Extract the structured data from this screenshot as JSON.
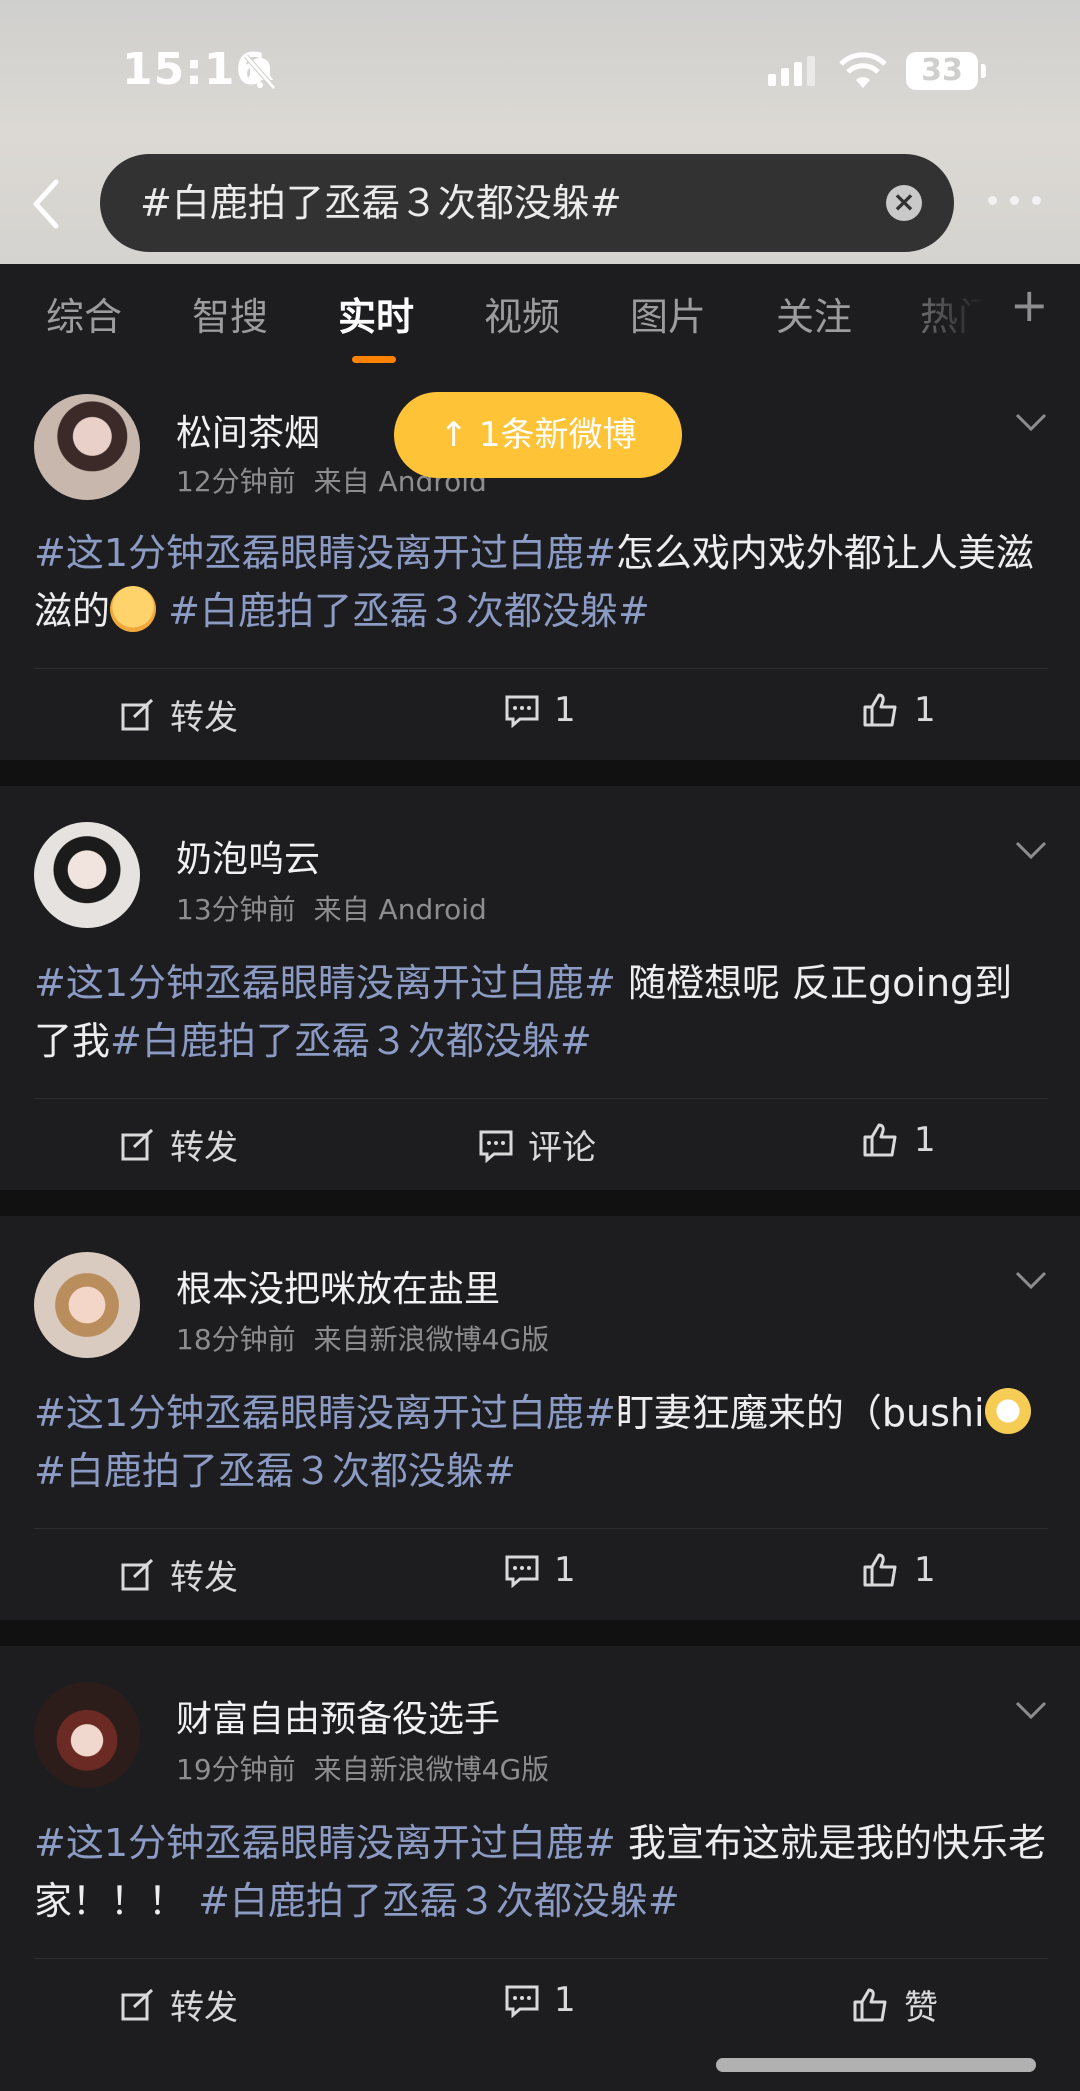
{
  "status_bar": {
    "time": "15:16",
    "battery": "33"
  },
  "search": {
    "query": "#白鹿拍了丞磊３次都没躲#",
    "clear": "×"
  },
  "tabs": [
    "综合",
    "智搜",
    "实时",
    "视频",
    "图片",
    "关注",
    "热门"
  ],
  "active_tab": "实时",
  "tab_plus": "+",
  "new_posts_banner": "↑ 1条新微博",
  "posts": [
    {
      "user": "松间茶烟",
      "time": "12分钟前",
      "source": "来自 Android",
      "content_parts": [
        "#这1分钟丞磊眼睛没离开过白鹿#",
        "怎么戏内戏外都让人美滋滋的",
        "#白鹿拍了丞磊３次都没躲#"
      ],
      "repost": "转发",
      "comment": "1",
      "like": "1"
    },
    {
      "user": "奶泡呜云",
      "time": "13分钟前",
      "source": "来自 Android",
      "content_parts": [
        "#这1分钟丞磊眼睛没离开过白鹿#",
        " 随橙想呢 反正going到了我",
        "#白鹿拍了丞磊３次都没躲#"
      ],
      "repost": "转发",
      "comment": "评论",
      "like": "1"
    },
    {
      "user": "根本没把咪放在盐里",
      "time": "18分钟前",
      "source": "来自新浪微博4G版",
      "content_parts": [
        "#这1分钟丞磊眼睛没离开过白鹿#",
        "盯妻狂魔来的（bushi",
        "#白鹿拍了丞磊３次都没躲#"
      ],
      "repost": "转发",
      "comment": "1",
      "like": "1"
    },
    {
      "user": "财富自由预备役选手",
      "time": "19分钟前",
      "source": "来自新浪微博4G版",
      "content_parts": [
        "#这1分钟丞磊眼睛没离开过白鹿#",
        " 我宣布这就是我的快乐老家！！！ ",
        "#白鹿拍了丞磊３次都没躲#"
      ],
      "repost": "转发",
      "comment": "1",
      "like": "赞"
    }
  ],
  "colors": {
    "accent": "#ff8200",
    "topic": "#8b9bc4",
    "banner": "#ffc338",
    "background": "#1d1d1f"
  }
}
